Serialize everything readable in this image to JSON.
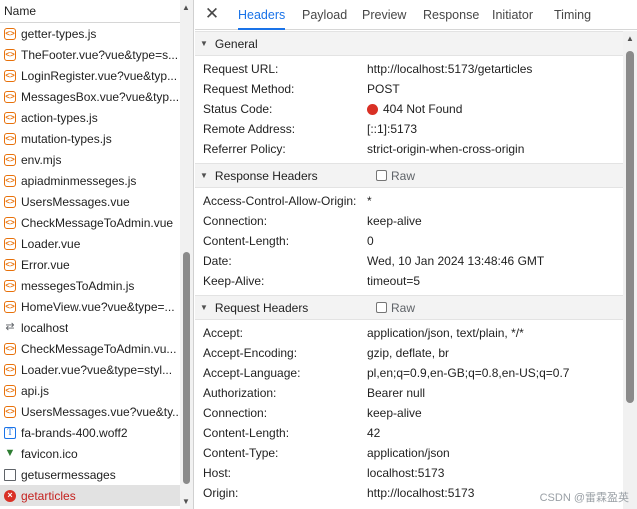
{
  "left_panel": {
    "header": "Name",
    "requests": [
      {
        "name": "getter-types.js",
        "icon": "script-icon"
      },
      {
        "name": "TheFooter.vue?vue&type=s...",
        "icon": "script-icon"
      },
      {
        "name": "LoginRegister.vue?vue&typ...",
        "icon": "script-icon"
      },
      {
        "name": "MessagesBox.vue?vue&typ...",
        "icon": "script-icon"
      },
      {
        "name": "action-types.js",
        "icon": "script-icon"
      },
      {
        "name": "mutation-types.js",
        "icon": "script-icon"
      },
      {
        "name": "env.mjs",
        "icon": "script-icon"
      },
      {
        "name": "apiadminmesseges.js",
        "icon": "script-icon"
      },
      {
        "name": "UsersMessages.vue",
        "icon": "script-icon"
      },
      {
        "name": "CheckMessageToAdmin.vue",
        "icon": "script-icon"
      },
      {
        "name": "Loader.vue",
        "icon": "script-icon"
      },
      {
        "name": "Error.vue",
        "icon": "script-icon"
      },
      {
        "name": "messegesToAdmin.js",
        "icon": "script-icon"
      },
      {
        "name": "HomeView.vue?vue&type=...",
        "icon": "script-icon"
      },
      {
        "name": "localhost",
        "icon": "websocket-icon"
      },
      {
        "name": "CheckMessageToAdmin.vu...",
        "icon": "script-icon"
      },
      {
        "name": "Loader.vue?vue&type=styl...",
        "icon": "script-icon"
      },
      {
        "name": "api.js",
        "icon": "script-icon"
      },
      {
        "name": "UsersMessages.vue?vue&ty...",
        "icon": "script-icon"
      },
      {
        "name": "fa-brands-400.woff2",
        "icon": "font-icon"
      },
      {
        "name": "favicon.ico",
        "icon": "favicon-icon"
      },
      {
        "name": "getusermessages",
        "icon": "document-icon"
      },
      {
        "name": "getarticles",
        "icon": "error-icon"
      }
    ],
    "selected_index": 22
  },
  "tabs": [
    "Headers",
    "Payload",
    "Preview",
    "Response",
    "Initiator",
    "Timing"
  ],
  "active_tab": "Headers",
  "general": {
    "title": "General",
    "rows": [
      {
        "key": "Request URL:",
        "value": "http://localhost:5173/getarticles"
      },
      {
        "key": "Request Method:",
        "value": "POST"
      },
      {
        "key": "Status Code:",
        "value": "404 Not Found"
      },
      {
        "key": "Remote Address:",
        "value": "[::1]:5173"
      },
      {
        "key": "Referrer Policy:",
        "value": "strict-origin-when-cross-origin"
      }
    ]
  },
  "response_headers": {
    "title": "Response Headers",
    "raw_label": "Raw",
    "rows": [
      {
        "key": "Access-Control-Allow-Origin:",
        "value": "*"
      },
      {
        "key": "Connection:",
        "value": "keep-alive"
      },
      {
        "key": "Content-Length:",
        "value": "0"
      },
      {
        "key": "Date:",
        "value": "Wed, 10 Jan 2024 13:48:46 GMT"
      },
      {
        "key": "Keep-Alive:",
        "value": "timeout=5"
      }
    ]
  },
  "request_headers": {
    "title": "Request Headers",
    "raw_label": "Raw",
    "rows": [
      {
        "key": "Accept:",
        "value": "application/json, text/plain, */*"
      },
      {
        "key": "Accept-Encoding:",
        "value": "gzip, deflate, br"
      },
      {
        "key": "Accept-Language:",
        "value": "pl,en;q=0.9,en-GB;q=0.8,en-US;q=0.7"
      },
      {
        "key": "Authorization:",
        "value": "Bearer null"
      },
      {
        "key": "Connection:",
        "value": "keep-alive"
      },
      {
        "key": "Content-Length:",
        "value": "42"
      },
      {
        "key": "Content-Type:",
        "value": "application/json"
      },
      {
        "key": "Host:",
        "value": "localhost:5173"
      },
      {
        "key": "Origin:",
        "value": "http://localhost:5173"
      }
    ]
  },
  "watermark": "CSDN @雷霖盈英",
  "colors": {
    "accent": "#1a73e8",
    "error": "#d93025",
    "selected_row_bg": "#e2e2e2"
  }
}
